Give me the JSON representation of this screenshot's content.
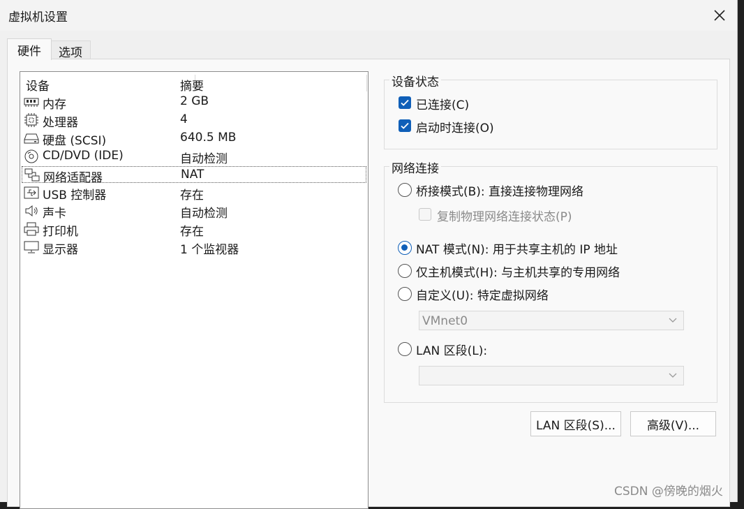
{
  "window": {
    "title": "虚拟机设置"
  },
  "tabs": [
    {
      "label": "硬件"
    },
    {
      "label": "选项"
    }
  ],
  "device_list": {
    "headers": {
      "device": "设备",
      "summary": "摘要"
    },
    "rows": [
      {
        "name": "内存",
        "value": "2 GB",
        "icon": "memory-icon"
      },
      {
        "name": "处理器",
        "value": "4",
        "icon": "processor-icon"
      },
      {
        "name": "硬盘 (SCSI)",
        "value": "640.5 MB",
        "icon": "hard-disk-icon"
      },
      {
        "name": "CD/DVD (IDE)",
        "value": "自动检测",
        "icon": "cd-dvd-icon"
      },
      {
        "name": "网络适配器",
        "value": "NAT",
        "icon": "network-adapter-icon",
        "selected": true
      },
      {
        "name": "USB 控制器",
        "value": "存在",
        "icon": "usb-icon"
      },
      {
        "name": "声卡",
        "value": "自动检测",
        "icon": "speaker-icon"
      },
      {
        "name": "打印机",
        "value": "存在",
        "icon": "printer-icon"
      },
      {
        "name": "显示器",
        "value": "1 个监视器",
        "icon": "monitor-icon"
      }
    ]
  },
  "device_status": {
    "title": "设备状态",
    "connected": {
      "label": "已连接(C)",
      "checked": true
    },
    "connect_at_power_on": {
      "label": "启动时连接(O)",
      "checked": true
    }
  },
  "network_connection": {
    "title": "网络连接",
    "bridged": {
      "label": "桥接模式(B): 直接连接物理网络",
      "selected": false
    },
    "replicate": {
      "label": "复制物理网络连接状态(P)",
      "checked": false,
      "disabled": true
    },
    "nat": {
      "label": "NAT 模式(N): 用于共享主机的 IP 地址",
      "selected": true
    },
    "host_only": {
      "label": "仅主机模式(H): 与主机共享的专用网络",
      "selected": false
    },
    "custom": {
      "label": "自定义(U): 特定虚拟网络",
      "selected": false
    },
    "custom_select": {
      "value": "VMnet0"
    },
    "lan_segment": {
      "label": "LAN 区段(L):",
      "selected": false
    },
    "lan_select": {
      "value": ""
    }
  },
  "buttons": {
    "lan_segments": "LAN 区段(S)...",
    "advanced": "高级(V)..."
  },
  "watermark": "CSDN @傍晚的烟火",
  "colors": {
    "accent": "#0f5fb8",
    "disabled_text": "#8a8a8a"
  }
}
